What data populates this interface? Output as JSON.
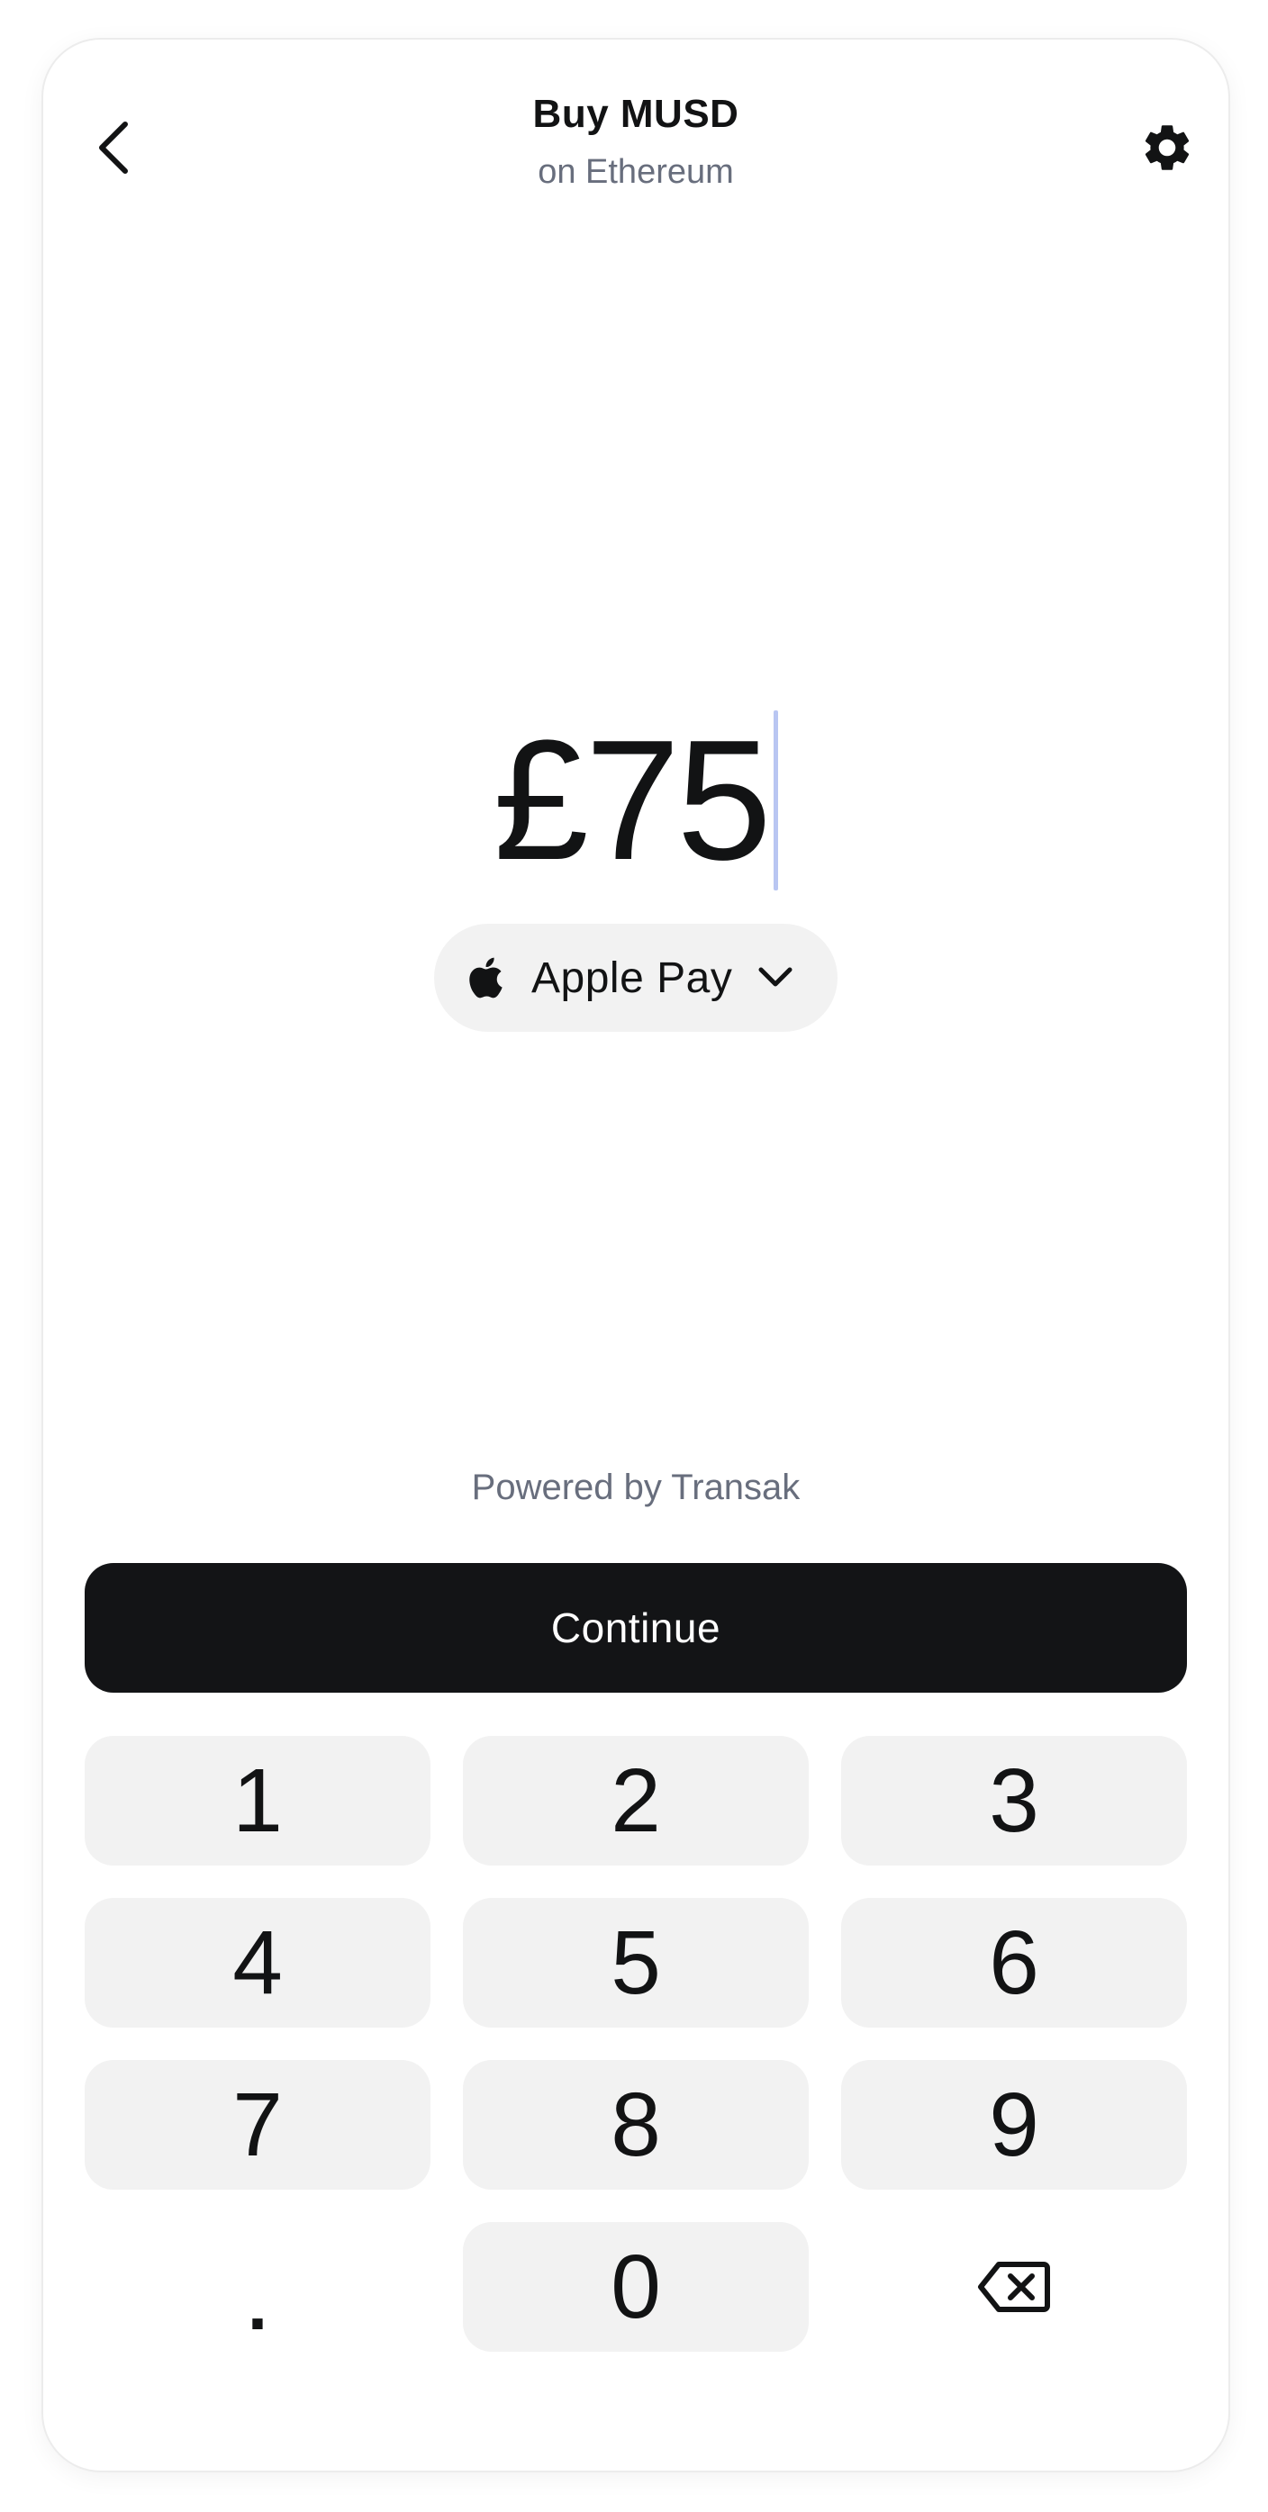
{
  "header": {
    "title": "Buy MUSD",
    "subtitle": "on Ethereum",
    "back_icon": "chevron-left-icon",
    "settings_icon": "gear-icon"
  },
  "amount": {
    "value": "£75"
  },
  "payment_method": {
    "icon": "apple-icon",
    "label": "Apple Pay",
    "dropdown_icon": "chevron-down-icon"
  },
  "footer": {
    "powered_by": "Powered by Transak",
    "continue_label": "Continue"
  },
  "keypad": {
    "keys": [
      "1",
      "2",
      "3",
      "4",
      "5",
      "6",
      "7",
      "8",
      "9",
      ".",
      "0"
    ],
    "backspace_icon": "backspace-icon"
  },
  "colors": {
    "primary_button": "#131416",
    "key_background": "#f2f2f2",
    "muted_text": "#686e7d",
    "caret": "#b9c6f2"
  }
}
